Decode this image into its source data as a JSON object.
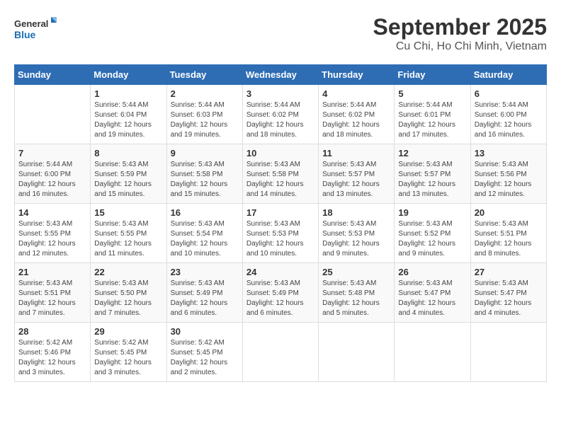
{
  "header": {
    "logo_line1": "General",
    "logo_line2": "Blue",
    "title": "September 2025",
    "subtitle": "Cu Chi, Ho Chi Minh, Vietnam"
  },
  "days": [
    "Sunday",
    "Monday",
    "Tuesday",
    "Wednesday",
    "Thursday",
    "Friday",
    "Saturday"
  ],
  "weeks": [
    [
      {
        "date": "",
        "content": ""
      },
      {
        "date": "1",
        "content": "Sunrise: 5:44 AM\nSunset: 6:04 PM\nDaylight: 12 hours\nand 19 minutes."
      },
      {
        "date": "2",
        "content": "Sunrise: 5:44 AM\nSunset: 6:03 PM\nDaylight: 12 hours\nand 19 minutes."
      },
      {
        "date": "3",
        "content": "Sunrise: 5:44 AM\nSunset: 6:02 PM\nDaylight: 12 hours\nand 18 minutes."
      },
      {
        "date": "4",
        "content": "Sunrise: 5:44 AM\nSunset: 6:02 PM\nDaylight: 12 hours\nand 18 minutes."
      },
      {
        "date": "5",
        "content": "Sunrise: 5:44 AM\nSunset: 6:01 PM\nDaylight: 12 hours\nand 17 minutes."
      },
      {
        "date": "6",
        "content": "Sunrise: 5:44 AM\nSunset: 6:00 PM\nDaylight: 12 hours\nand 16 minutes."
      }
    ],
    [
      {
        "date": "7",
        "content": "Sunrise: 5:44 AM\nSunset: 6:00 PM\nDaylight: 12 hours\nand 16 minutes."
      },
      {
        "date": "8",
        "content": "Sunrise: 5:43 AM\nSunset: 5:59 PM\nDaylight: 12 hours\nand 15 minutes."
      },
      {
        "date": "9",
        "content": "Sunrise: 5:43 AM\nSunset: 5:58 PM\nDaylight: 12 hours\nand 15 minutes."
      },
      {
        "date": "10",
        "content": "Sunrise: 5:43 AM\nSunset: 5:58 PM\nDaylight: 12 hours\nand 14 minutes."
      },
      {
        "date": "11",
        "content": "Sunrise: 5:43 AM\nSunset: 5:57 PM\nDaylight: 12 hours\nand 13 minutes."
      },
      {
        "date": "12",
        "content": "Sunrise: 5:43 AM\nSunset: 5:57 PM\nDaylight: 12 hours\nand 13 minutes."
      },
      {
        "date": "13",
        "content": "Sunrise: 5:43 AM\nSunset: 5:56 PM\nDaylight: 12 hours\nand 12 minutes."
      }
    ],
    [
      {
        "date": "14",
        "content": "Sunrise: 5:43 AM\nSunset: 5:55 PM\nDaylight: 12 hours\nand 12 minutes."
      },
      {
        "date": "15",
        "content": "Sunrise: 5:43 AM\nSunset: 5:55 PM\nDaylight: 12 hours\nand 11 minutes."
      },
      {
        "date": "16",
        "content": "Sunrise: 5:43 AM\nSunset: 5:54 PM\nDaylight: 12 hours\nand 10 minutes."
      },
      {
        "date": "17",
        "content": "Sunrise: 5:43 AM\nSunset: 5:53 PM\nDaylight: 12 hours\nand 10 minutes."
      },
      {
        "date": "18",
        "content": "Sunrise: 5:43 AM\nSunset: 5:53 PM\nDaylight: 12 hours\nand 9 minutes."
      },
      {
        "date": "19",
        "content": "Sunrise: 5:43 AM\nSunset: 5:52 PM\nDaylight: 12 hours\nand 9 minutes."
      },
      {
        "date": "20",
        "content": "Sunrise: 5:43 AM\nSunset: 5:51 PM\nDaylight: 12 hours\nand 8 minutes."
      }
    ],
    [
      {
        "date": "21",
        "content": "Sunrise: 5:43 AM\nSunset: 5:51 PM\nDaylight: 12 hours\nand 7 minutes."
      },
      {
        "date": "22",
        "content": "Sunrise: 5:43 AM\nSunset: 5:50 PM\nDaylight: 12 hours\nand 7 minutes."
      },
      {
        "date": "23",
        "content": "Sunrise: 5:43 AM\nSunset: 5:49 PM\nDaylight: 12 hours\nand 6 minutes."
      },
      {
        "date": "24",
        "content": "Sunrise: 5:43 AM\nSunset: 5:49 PM\nDaylight: 12 hours\nand 6 minutes."
      },
      {
        "date": "25",
        "content": "Sunrise: 5:43 AM\nSunset: 5:48 PM\nDaylight: 12 hours\nand 5 minutes."
      },
      {
        "date": "26",
        "content": "Sunrise: 5:43 AM\nSunset: 5:47 PM\nDaylight: 12 hours\nand 4 minutes."
      },
      {
        "date": "27",
        "content": "Sunrise: 5:43 AM\nSunset: 5:47 PM\nDaylight: 12 hours\nand 4 minutes."
      }
    ],
    [
      {
        "date": "28",
        "content": "Sunrise: 5:42 AM\nSunset: 5:46 PM\nDaylight: 12 hours\nand 3 minutes."
      },
      {
        "date": "29",
        "content": "Sunrise: 5:42 AM\nSunset: 5:45 PM\nDaylight: 12 hours\nand 3 minutes."
      },
      {
        "date": "30",
        "content": "Sunrise: 5:42 AM\nSunset: 5:45 PM\nDaylight: 12 hours\nand 2 minutes."
      },
      {
        "date": "",
        "content": ""
      },
      {
        "date": "",
        "content": ""
      },
      {
        "date": "",
        "content": ""
      },
      {
        "date": "",
        "content": ""
      }
    ]
  ]
}
